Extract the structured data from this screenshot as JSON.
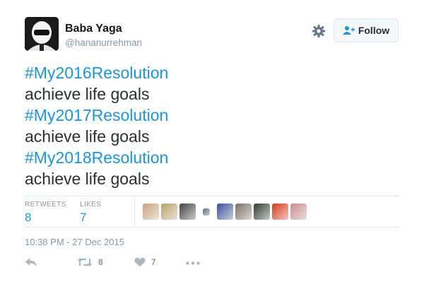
{
  "user": {
    "name": "Baba Yaga",
    "handle": "@hananurrehman",
    "avatar_icon": "helmet-avatar"
  },
  "follow_button": {
    "label": "Follow",
    "icon": "add-user-icon"
  },
  "settings_icon": "gear-icon",
  "tweet": {
    "lines": [
      {
        "text": "#My2016Resolution",
        "type": "hashtag"
      },
      {
        "text": "achieve life goals",
        "type": "plain"
      },
      {
        "text": "#My2017Resolution",
        "type": "hashtag"
      },
      {
        "text": "achieve life goals",
        "type": "plain"
      },
      {
        "text": "#My2018Resolution",
        "type": "hashtag"
      },
      {
        "text": "achieve life goals",
        "type": "plain"
      }
    ]
  },
  "stats": {
    "retweets_label": "RETWEETS",
    "retweets_value": "8",
    "likes_label": "LIKES",
    "likes_value": "7"
  },
  "likers": [
    {
      "name": "liker-avatar-1",
      "color": "#c9a27d"
    },
    {
      "name": "liker-avatar-2",
      "color": "#b8a06a"
    },
    {
      "name": "liker-avatar-3",
      "color": "#444444"
    },
    {
      "name": "liker-avatar-4",
      "color": "#5a6a7d"
    },
    {
      "name": "liker-avatar-5",
      "color": "#3d4f9b"
    },
    {
      "name": "liker-avatar-6",
      "color": "#7a6f66"
    },
    {
      "name": "liker-avatar-7",
      "color": "#2f3d33"
    },
    {
      "name": "liker-avatar-8",
      "color": "#d43a1f"
    },
    {
      "name": "liker-avatar-9",
      "color": "#c98b8b"
    }
  ],
  "timestamp": "10:38 PM - 27 Dec 2015",
  "actions": {
    "reply_icon": "reply-icon",
    "retweet_icon": "retweet-icon",
    "retweet_count": "8",
    "like_icon": "heart-icon",
    "like_count": "7",
    "more_icon": "more-icon"
  },
  "colors": {
    "accent": "#1b95e0",
    "text": "#292f33",
    "muted": "#8899a6",
    "border": "#e1e8ed"
  }
}
